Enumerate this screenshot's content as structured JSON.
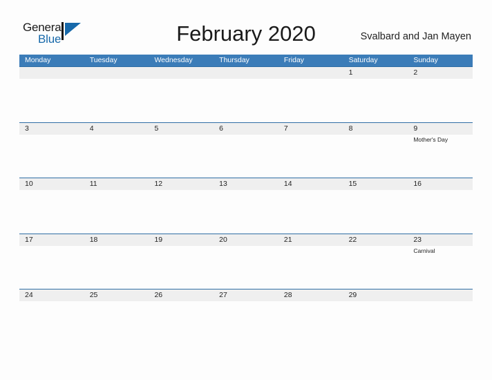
{
  "logo": {
    "word_one": "General",
    "word_two": "Blue",
    "mark": "triangle-logo-icon",
    "brand_color": "#1769aa"
  },
  "header": {
    "title": "February 2020",
    "region": "Svalbard and Jan Mayen"
  },
  "calendar": {
    "header_color": "#3b7cb8",
    "row_line_color": "#2e6da4",
    "band_color": "#efefef",
    "weekdays": [
      "Monday",
      "Tuesday",
      "Wednesday",
      "Thursday",
      "Friday",
      "Saturday",
      "Sunday"
    ],
    "weeks": [
      [
        {
          "date": ""
        },
        {
          "date": ""
        },
        {
          "date": ""
        },
        {
          "date": ""
        },
        {
          "date": ""
        },
        {
          "date": "1"
        },
        {
          "date": "2"
        }
      ],
      [
        {
          "date": "3"
        },
        {
          "date": "4"
        },
        {
          "date": "5"
        },
        {
          "date": "6"
        },
        {
          "date": "7"
        },
        {
          "date": "8"
        },
        {
          "date": "9",
          "event": "Mother's Day"
        }
      ],
      [
        {
          "date": "10"
        },
        {
          "date": "11"
        },
        {
          "date": "12"
        },
        {
          "date": "13"
        },
        {
          "date": "14"
        },
        {
          "date": "15"
        },
        {
          "date": "16"
        }
      ],
      [
        {
          "date": "17"
        },
        {
          "date": "18"
        },
        {
          "date": "19"
        },
        {
          "date": "20"
        },
        {
          "date": "21"
        },
        {
          "date": "22"
        },
        {
          "date": "23",
          "event": "Carnival"
        }
      ],
      [
        {
          "date": "24"
        },
        {
          "date": "25"
        },
        {
          "date": "26"
        },
        {
          "date": "27"
        },
        {
          "date": "28"
        },
        {
          "date": "29"
        },
        {
          "date": ""
        }
      ]
    ]
  }
}
